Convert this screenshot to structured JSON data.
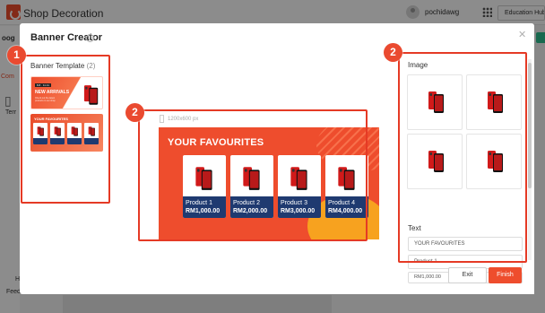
{
  "app": {
    "title": "Shop Decoration",
    "username": "pochidawg",
    "education_hub": "Education Hub"
  },
  "background": {
    "left_snippets": [
      "oog",
      "Com",
      "Terr",
      "He"
    ],
    "feedback": "Feedback"
  },
  "modal": {
    "title": "Banner Creator",
    "left_panel": {
      "title": "Banner Template",
      "count": "(2)",
      "templates": [
        {
          "badge": "8.8 · 11.11",
          "heading": "NEW ARRIVALS",
          "subtitle": "Check out the latest products in our shop"
        },
        {
          "heading": "YOUR FAVOURITES"
        }
      ]
    },
    "canvas": {
      "size_label": "1200x600 px",
      "banner_title": "YOUR FAVOURITES",
      "products": [
        {
          "name": "Product 1",
          "price": "RM1,000.00"
        },
        {
          "name": "Product 2",
          "price": "RM2,000.00"
        },
        {
          "name": "Product 3",
          "price": "RM3,000.00"
        },
        {
          "name": "Product 4",
          "price": "RM4,000.00"
        }
      ]
    },
    "right_panel": {
      "image_label": "Image",
      "text_label": "Text",
      "fields": [
        "YOUR FAVOURITES",
        "Product 1",
        "RM1,000.00"
      ]
    },
    "buttons": {
      "exit": "Exit",
      "finish": "Finish"
    }
  },
  "annotations": {
    "badge_1": "1",
    "badge_2a": "2",
    "badge_2b": "2"
  },
  "colors": {
    "accent": "#ee4d2d",
    "card_footer": "#1f3a70",
    "highlight": "#e53a25"
  }
}
